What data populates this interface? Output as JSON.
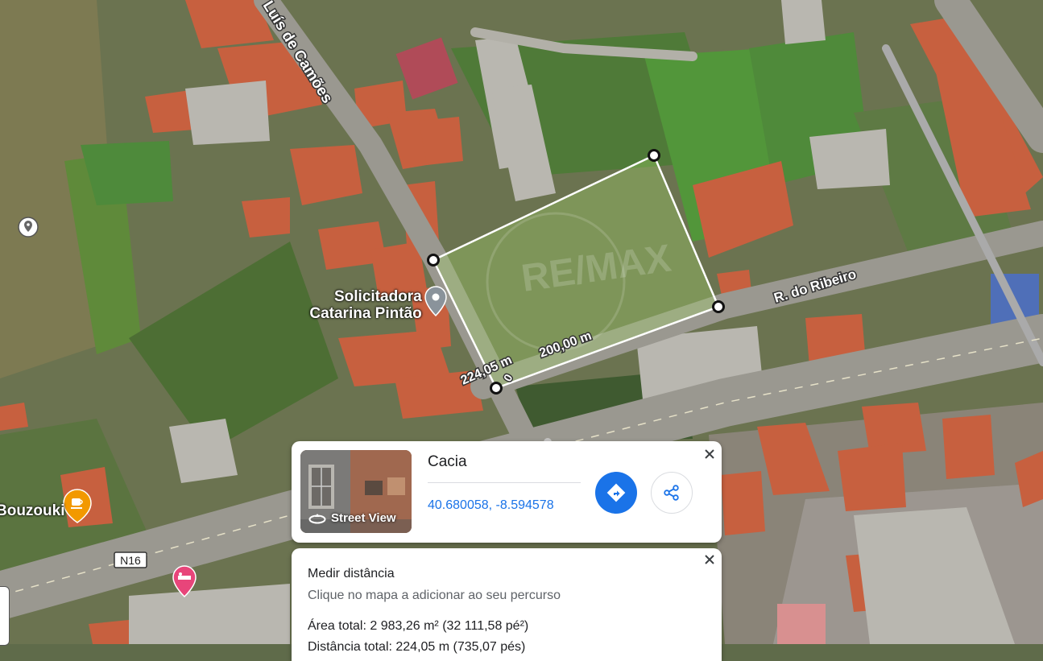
{
  "map": {
    "roads": {
      "luis_de_camoes": "Luís de Camões",
      "do_ribeiro": "R. do Ribeiro",
      "n16": "N16"
    },
    "pois": [
      {
        "label_line1": "Solicitadora",
        "label_line2": "Catarina Pintão",
        "icon": "place-pin-icon"
      },
      {
        "label": "Bouzouki",
        "icon": "cafe-icon"
      }
    ],
    "measurement": {
      "side_a": "224,05 m",
      "side_b": "200,00 m",
      "side_c": "0"
    },
    "watermark": "RE/MAX",
    "colors": {
      "measure_line": "#ffffff",
      "cafe_pin": "#f29900",
      "hotel_pin": "#e8457a"
    }
  },
  "place_card": {
    "title": "Cacia",
    "coordinates": "40.680058, -8.594578",
    "street_view_label": "Street View",
    "accent": "#1a73e8"
  },
  "measure_card": {
    "title": "Medir distância",
    "hint": "Clique no mapa a adicionar ao seu percurso",
    "total_area": "Área total: 2 983,26 m² (32 111,58 pé²)",
    "total_distance": "Distância total: 224,05 m (735,07 pés)"
  }
}
